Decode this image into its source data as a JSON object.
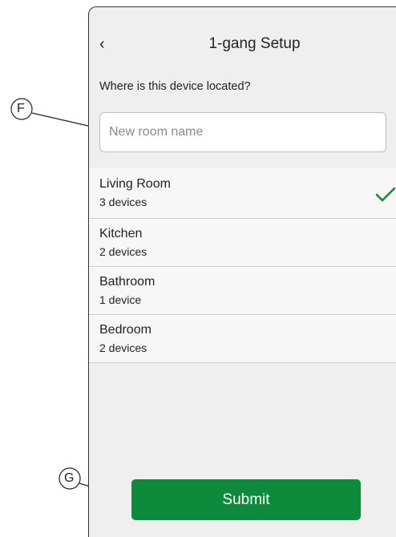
{
  "header": {
    "back_icon": "chevron-left-icon",
    "back_glyph": "‹",
    "title": "1-gang Setup"
  },
  "question": "Where is this device located?",
  "room_input": {
    "placeholder": "New room name",
    "value": ""
  },
  "rooms": [
    {
      "name": "Living Room",
      "count": "3 devices",
      "selected": true
    },
    {
      "name": "Kitchen",
      "count": "2 devices",
      "selected": false
    },
    {
      "name": "Bathroom",
      "count": "1 device",
      "selected": false
    },
    {
      "name": "Bedroom",
      "count": "2 devices",
      "selected": false
    }
  ],
  "submit_label": "Submit",
  "callouts": {
    "f": "F",
    "g": "G"
  },
  "colors": {
    "accent_green": "#0e8a3c",
    "background": "#efefef",
    "selected_row": "#f7f7f7"
  }
}
